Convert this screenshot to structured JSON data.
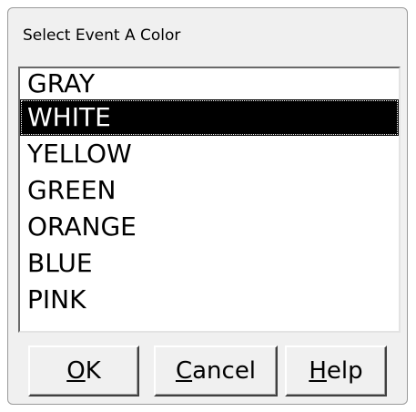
{
  "dialog": {
    "title": "Select Event A Color"
  },
  "color_list": {
    "items": [
      "GRAY",
      "WHITE",
      "YELLOW",
      "GREEN",
      "ORANGE",
      "BLUE",
      "PINK"
    ],
    "selected": "WHITE"
  },
  "buttons": {
    "ok": {
      "accel": "O",
      "rest": "K"
    },
    "cancel": {
      "accel": "C",
      "rest": "ancel"
    },
    "help": {
      "accel": "H",
      "rest": "elp"
    }
  }
}
